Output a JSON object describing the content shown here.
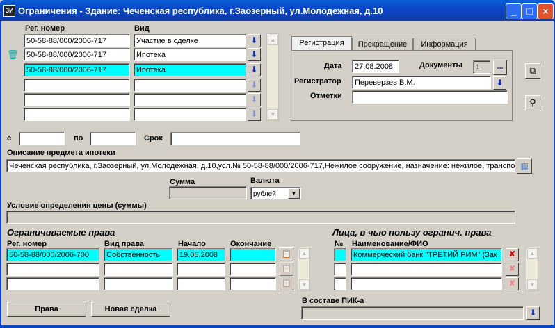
{
  "window": {
    "title": "Ограничения - Здание: Чеченская республика, г.Заозерный, ул.Молодежная, д.10",
    "icon_text": "ЗИ"
  },
  "top": {
    "reg_header": "Рег. номер",
    "vid_header": "Вид",
    "rows": [
      {
        "reg": "50-58-88/000/2006-717",
        "vid": "Участие в сделке"
      },
      {
        "reg": "50-58-88/000/2006-717",
        "vid": "Ипотека"
      },
      {
        "reg": "50-58-88/000/2006-717",
        "vid": "Ипотека"
      },
      {
        "reg": "",
        "vid": ""
      },
      {
        "reg": "",
        "vid": ""
      },
      {
        "reg": "",
        "vid": ""
      }
    ]
  },
  "tabs": {
    "t1": "Регистрация",
    "t2": "Прекращение",
    "t3": "Информация"
  },
  "reg_panel": {
    "date_label": "Дата",
    "date_value": "27.08.2008",
    "docs_label": "Документы",
    "docs_value": "1",
    "docs_btn": "...",
    "registrar_label": "Регистратор",
    "registrar_value": "Переверзев В.М.",
    "notes_label": "Отметки",
    "notes_value": ""
  },
  "period": {
    "from_label": "с",
    "to_label": "по",
    "term_label": "Срок"
  },
  "desc": {
    "label": "Описание предмета ипотеки",
    "value": "Чеченская республика, г.Заозерный, ул.Молодежная, д.10,усл.№ 50-58-88/000/2006-717,Нежилое сооружение, назначение: нежилое, транспорт"
  },
  "sum": {
    "sum_label": "Сумма",
    "currency_label": "Валюта",
    "currency_value": "рублей"
  },
  "price": {
    "label": "Условие определения цены (суммы)"
  },
  "rights": {
    "heading": "Ограничиваемые права",
    "h_reg": "Рег. номер",
    "h_type": "Вид права",
    "h_start": "Начало",
    "h_end": "Окончание",
    "rows": [
      {
        "reg": "50-58-88/000/2006-700",
        "type": "Собственность",
        "start": "19.06.2008",
        "end": ""
      },
      {
        "reg": "",
        "type": "",
        "start": "",
        "end": ""
      },
      {
        "reg": "",
        "type": "",
        "start": "",
        "end": ""
      }
    ]
  },
  "persons": {
    "heading": "Лица, в чью пользу огранич. права",
    "h_num": "№",
    "h_name": "Наименование/ФИО",
    "rows": [
      {
        "num": "",
        "name": "Коммерческий банк \"ТРЕТИЙ РИМ\" (Зак"
      },
      {
        "num": "",
        "name": ""
      },
      {
        "num": "",
        "name": ""
      }
    ]
  },
  "bottom": {
    "rights_btn": "Права",
    "new_deal_btn": "Новая сделка",
    "pik_label": "В составе ПИК-а",
    "pik_value": ""
  },
  "colors": {
    "title_bar": "#0a46c8",
    "selected": "#00ffff",
    "face": "#d4d0c8"
  }
}
